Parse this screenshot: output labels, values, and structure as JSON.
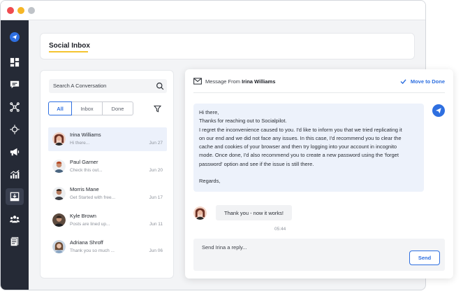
{
  "window": {
    "controls": [
      "close-icon",
      "minimize-icon",
      "maximize-icon"
    ]
  },
  "sidebar": {
    "items": [
      {
        "name": "paper-plane-icon",
        "active": false
      },
      {
        "name": "dashboard-icon",
        "active": false
      },
      {
        "name": "chat-icon",
        "active": false
      },
      {
        "name": "network-icon",
        "active": false
      },
      {
        "name": "move-icon",
        "active": false
      },
      {
        "name": "megaphone-icon",
        "active": false
      },
      {
        "name": "analytics-icon",
        "active": false
      },
      {
        "name": "inbox-icon",
        "active": true
      },
      {
        "name": "team-icon",
        "active": false
      },
      {
        "name": "document-icon",
        "active": false
      }
    ]
  },
  "header": {
    "title": "Social Inbox"
  },
  "conversations": {
    "search_placeholder": "Search A Conversation",
    "tabs": [
      {
        "label": "All",
        "active": true
      },
      {
        "label": "Inbox",
        "active": false
      },
      {
        "label": "Done",
        "active": false
      }
    ],
    "items": [
      {
        "name": "Irina Williams",
        "preview": "Hi there...",
        "date": "Jun 27",
        "active": true
      },
      {
        "name": "Paul Garner",
        "preview": "Check this out...",
        "date": "Jun 20",
        "active": false
      },
      {
        "name": "Morris Mane",
        "preview": "Get Started with free...",
        "date": "Jun 17",
        "active": false
      },
      {
        "name": "Kyle Brown",
        "preview": "Posts are lined up...",
        "date": "Jun 11",
        "active": false
      },
      {
        "name": "Adriana Shroff",
        "preview": "Thank you so much ...",
        "date": "Jun 06",
        "active": false
      }
    ]
  },
  "detail": {
    "from_prefix": "Message From",
    "from_name": "Irina Williams",
    "move_done_label": "Move to Done",
    "message_lines": [
      "Hi there,",
      "Thanks for reaching out to Socialpilot.",
      "I regret the inconvenience caused to you. I'd like to inform you that we tried replicating it",
      "on our end and we did not face any issues. In this case, I'd recommend you to clear the",
      "cache and cookies of your browser and then try logging into your account in incognito",
      "mode. Once done, I'd also recommend you to create a new password using the 'forget",
      "password' option and see if the issue is still there.",
      "",
      "Regards,"
    ],
    "reply_text": "Thank you - now it works!",
    "reply_time": "05:44",
    "composer_placeholder": "Send Irina a reply...",
    "send_label": "Send"
  },
  "colors": {
    "accent": "#2e6fe0",
    "sidebar_bg": "#252a36",
    "underline": "#f4c431"
  }
}
